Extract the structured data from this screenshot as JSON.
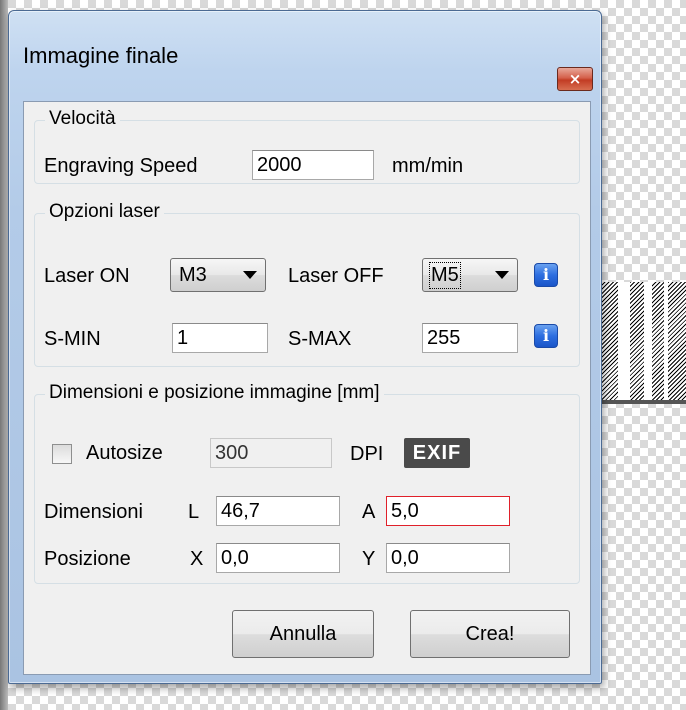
{
  "window": {
    "title": "Immagine finale",
    "close_glyph": "×"
  },
  "speed_group": {
    "title": "Velocità",
    "label": "Engraving Speed",
    "value": "2000",
    "unit": "mm/min"
  },
  "laser_group": {
    "title": "Opzioni laser",
    "laser_on_label": "Laser ON",
    "laser_on_value": "M3",
    "laser_off_label": "Laser OFF",
    "laser_off_value": "M5",
    "smin_label": "S-MIN",
    "smin_value": "1",
    "smax_label": "S-MAX",
    "smax_value": "255",
    "info_glyph": "i"
  },
  "dimension_group": {
    "title": "Dimensioni e posizione immagine [mm]",
    "autosize_label": "Autosize",
    "autosize_checked": false,
    "dpi_value": "300",
    "dpi_label": "DPI",
    "exif_label": "EXIF",
    "dimensioni_label": "Dimensioni",
    "l_label": "L",
    "l_value": "46,7",
    "a_label": "A",
    "a_value": "5,0",
    "posizione_label": "Posizione",
    "x_label": "X",
    "x_value": "0,0",
    "y_label": "Y",
    "y_value": "0,0"
  },
  "buttons": {
    "cancel": "Annulla",
    "create": "Crea!"
  },
  "colors": {
    "error_border": "#e0202a",
    "info_icon": "#2d6ee0",
    "close_button": "#c23c24"
  }
}
